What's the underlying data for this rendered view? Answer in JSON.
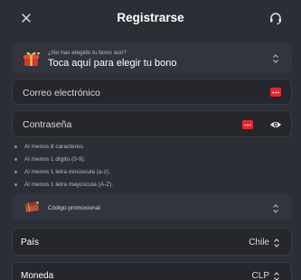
{
  "header": {
    "title": "Registrarse",
    "close_icon": "close-icon",
    "support_icon": "support-headset-icon"
  },
  "bonus": {
    "question": "¿No has elegido tu bono aún?",
    "cta": "Toca aquí para elegir tu bono",
    "icon": "gift-icon"
  },
  "form": {
    "email_placeholder": "Correo electrónico",
    "password_placeholder": "Contraseña"
  },
  "password_rules": [
    "Al menos 8 caracteres.",
    "Al menos 1 dígito (0-9).",
    "Al menos 1 letra minúscula (a-z).",
    "Al menos 1 letra mayúscula (A-Z)."
  ],
  "promo": {
    "label": "Código promocional",
    "icon": "ticket-icon"
  },
  "country": {
    "label": "País",
    "value": "Chile"
  },
  "currency": {
    "label": "Moneda",
    "value": "CLP"
  },
  "colors": {
    "background": "#2b2e35",
    "field": "#25272d",
    "accent_red": "#e5262e"
  }
}
